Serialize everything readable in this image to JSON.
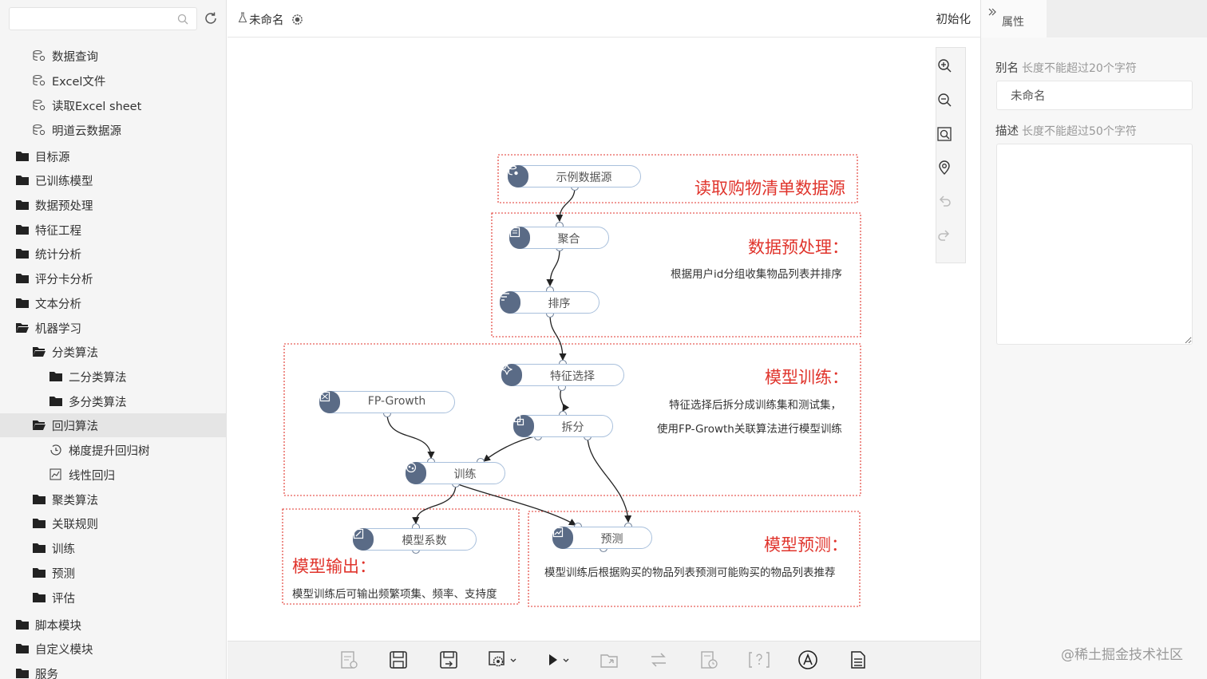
{
  "sidebar": {
    "search": {
      "placeholder": ""
    },
    "items": [
      {
        "label": "数据查询",
        "icon": "database-icon"
      },
      {
        "label": "Excel文件",
        "icon": "database-icon"
      },
      {
        "label": "读取Excel sheet",
        "icon": "database-icon"
      },
      {
        "label": "明道云数据源",
        "icon": "database-icon"
      },
      {
        "label": "目标源",
        "icon": "folder-icon"
      },
      {
        "label": "已训练模型",
        "icon": "folder-icon"
      },
      {
        "label": "数据预处理",
        "icon": "folder-icon"
      },
      {
        "label": "特征工程",
        "icon": "folder-icon"
      },
      {
        "label": "统计分析",
        "icon": "folder-icon"
      },
      {
        "label": "评分卡分析",
        "icon": "folder-icon"
      },
      {
        "label": "文本分析",
        "icon": "folder-icon"
      },
      {
        "label": "机器学习",
        "icon": "folder-open-icon"
      },
      {
        "label": "分类算法",
        "icon": "folder-open-icon"
      },
      {
        "label": "二分类算法",
        "icon": "folder-icon"
      },
      {
        "label": "多分类算法",
        "icon": "folder-icon"
      },
      {
        "label": "回归算法",
        "icon": "folder-open-icon"
      },
      {
        "label": "梯度提升回归树",
        "icon": "clock-icon"
      },
      {
        "label": "线性回归",
        "icon": "chart-icon"
      },
      {
        "label": "聚类算法",
        "icon": "folder-icon"
      },
      {
        "label": "关联规则",
        "icon": "folder-icon"
      },
      {
        "label": "训练",
        "icon": "folder-icon"
      },
      {
        "label": "预测",
        "icon": "folder-icon"
      },
      {
        "label": "评估",
        "icon": "folder-icon"
      },
      {
        "label": "脚本模块",
        "icon": "folder-icon"
      },
      {
        "label": "自定义模块",
        "icon": "folder-icon"
      },
      {
        "label": "服务",
        "icon": "folder-icon"
      }
    ],
    "selected": "回归算法"
  },
  "topbar": {
    "flow_name": "未命名",
    "init_label": "初始化"
  },
  "canvas": {
    "nodes": [
      {
        "id": "sample",
        "label": "示例数据源",
        "icon": "database-icon"
      },
      {
        "id": "agg",
        "label": "聚合",
        "icon": "aggregate-icon"
      },
      {
        "id": "sort",
        "label": "排序",
        "icon": "sort-icon"
      },
      {
        "id": "feat",
        "label": "特征选择",
        "icon": "feature-icon"
      },
      {
        "id": "fpg",
        "label": "FP-Growth",
        "icon": "algorithm-icon"
      },
      {
        "id": "split",
        "label": "拆分",
        "icon": "split-icon"
      },
      {
        "id": "train",
        "label": "训练",
        "icon": "train-icon"
      },
      {
        "id": "coef",
        "label": "模型系数",
        "icon": "coefficient-icon"
      },
      {
        "id": "predict",
        "label": "预测",
        "icon": "predict-icon"
      }
    ],
    "regions": [
      {
        "title": "读取购物清单数据源",
        "desc": ""
      },
      {
        "title": "数据预处理：",
        "desc": "根据用户id分组收集物品列表并排序"
      },
      {
        "title": "模型训练：",
        "desc": "特征选择后拆分成训练集和测试集，",
        "desc2": "使用FP-Growth关联算法进行模型训练"
      },
      {
        "title": "模型输出：",
        "desc": "模型训练后可输出频繁项集、频率、支持度"
      },
      {
        "title": "模型预测：",
        "desc": "模型训练后根据购买的物品列表预测可能购买的物品列表推荐"
      }
    ]
  },
  "zoom_tools": [
    "zoom-in-icon",
    "zoom-out-icon",
    "fit-icon",
    "locate-icon",
    "undo-icon",
    "redo-icon"
  ],
  "toolbar": [
    "report-icon",
    "save-icon",
    "save-as-icon",
    "settings-dropdown-icon",
    "run-dropdown-icon",
    "export-icon",
    "switch-icon",
    "schedule-icon",
    "help-icon",
    "format-icon",
    "document-icon"
  ],
  "properties": {
    "tab_label": "属性",
    "alias_label": "别名",
    "alias_hint": "长度不能超过20个字符",
    "alias_value": "未命名",
    "desc_label": "描述",
    "desc_hint": "长度不能超过50个字符",
    "desc_value": ""
  },
  "watermark": "@稀土掘金技术社区",
  "colors": {
    "region_border": "#e0342c",
    "node_border": "#a9c0dc",
    "node_badge": "#5a6b86"
  }
}
